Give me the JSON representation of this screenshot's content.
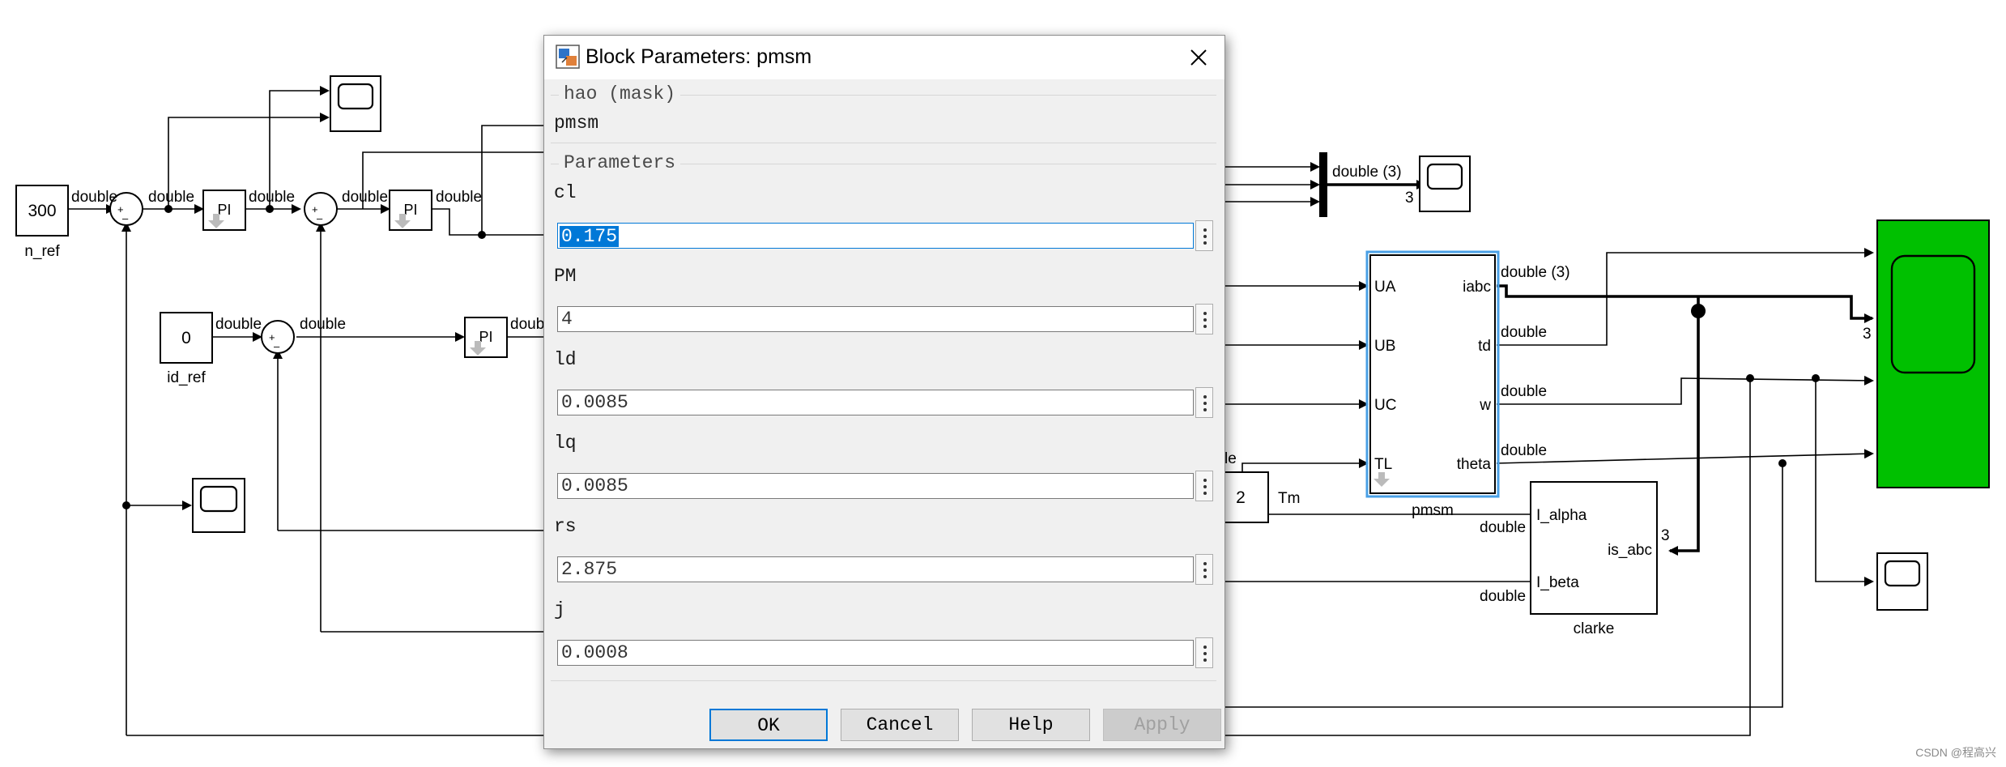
{
  "model": {
    "constants": {
      "n_ref_value": "300",
      "n_ref_name": "n_ref",
      "id_ref_value": "0",
      "id_ref_name": "id_ref",
      "tm_value": "2",
      "tm_name": "Tm"
    },
    "sum_signs": {
      "plus": "+",
      "minus": "–"
    },
    "pi_label": "PI",
    "signal_type": "double",
    "signal_type_bus": "double (3)",
    "bus_width": "3",
    "pmsm_block": {
      "name": "pmsm",
      "inputs": [
        "UA",
        "UB",
        "UC",
        "TL"
      ],
      "outputs": [
        "iabc",
        "td",
        "w",
        "theta"
      ],
      "partial_label": "le"
    },
    "clarke_block": {
      "name": "clarke",
      "inputs": [
        "I_alpha",
        "I_beta"
      ],
      "output": "is_abc"
    },
    "colors": {
      "scope_large": "#00c000",
      "bus_bar": "#000000",
      "highlight": "#4aa0e6"
    }
  },
  "dialog": {
    "title": "Block Parameters: pmsm",
    "mask_group": "hao (mask)",
    "description": "pmsm",
    "parameters_group": "Parameters",
    "params": [
      {
        "name": "cl",
        "value": "0.175"
      },
      {
        "name": "PM",
        "value": "4"
      },
      {
        "name": "ld",
        "value": "0.0085"
      },
      {
        "name": "lq",
        "value": "0.0085"
      },
      {
        "name": "rs",
        "value": "2.875"
      },
      {
        "name": "j",
        "value": "0.0008"
      }
    ],
    "buttons": {
      "ok": "OK",
      "cancel": "Cancel",
      "help": "Help",
      "apply": "Apply"
    }
  },
  "watermark": "CSDN @程高兴"
}
